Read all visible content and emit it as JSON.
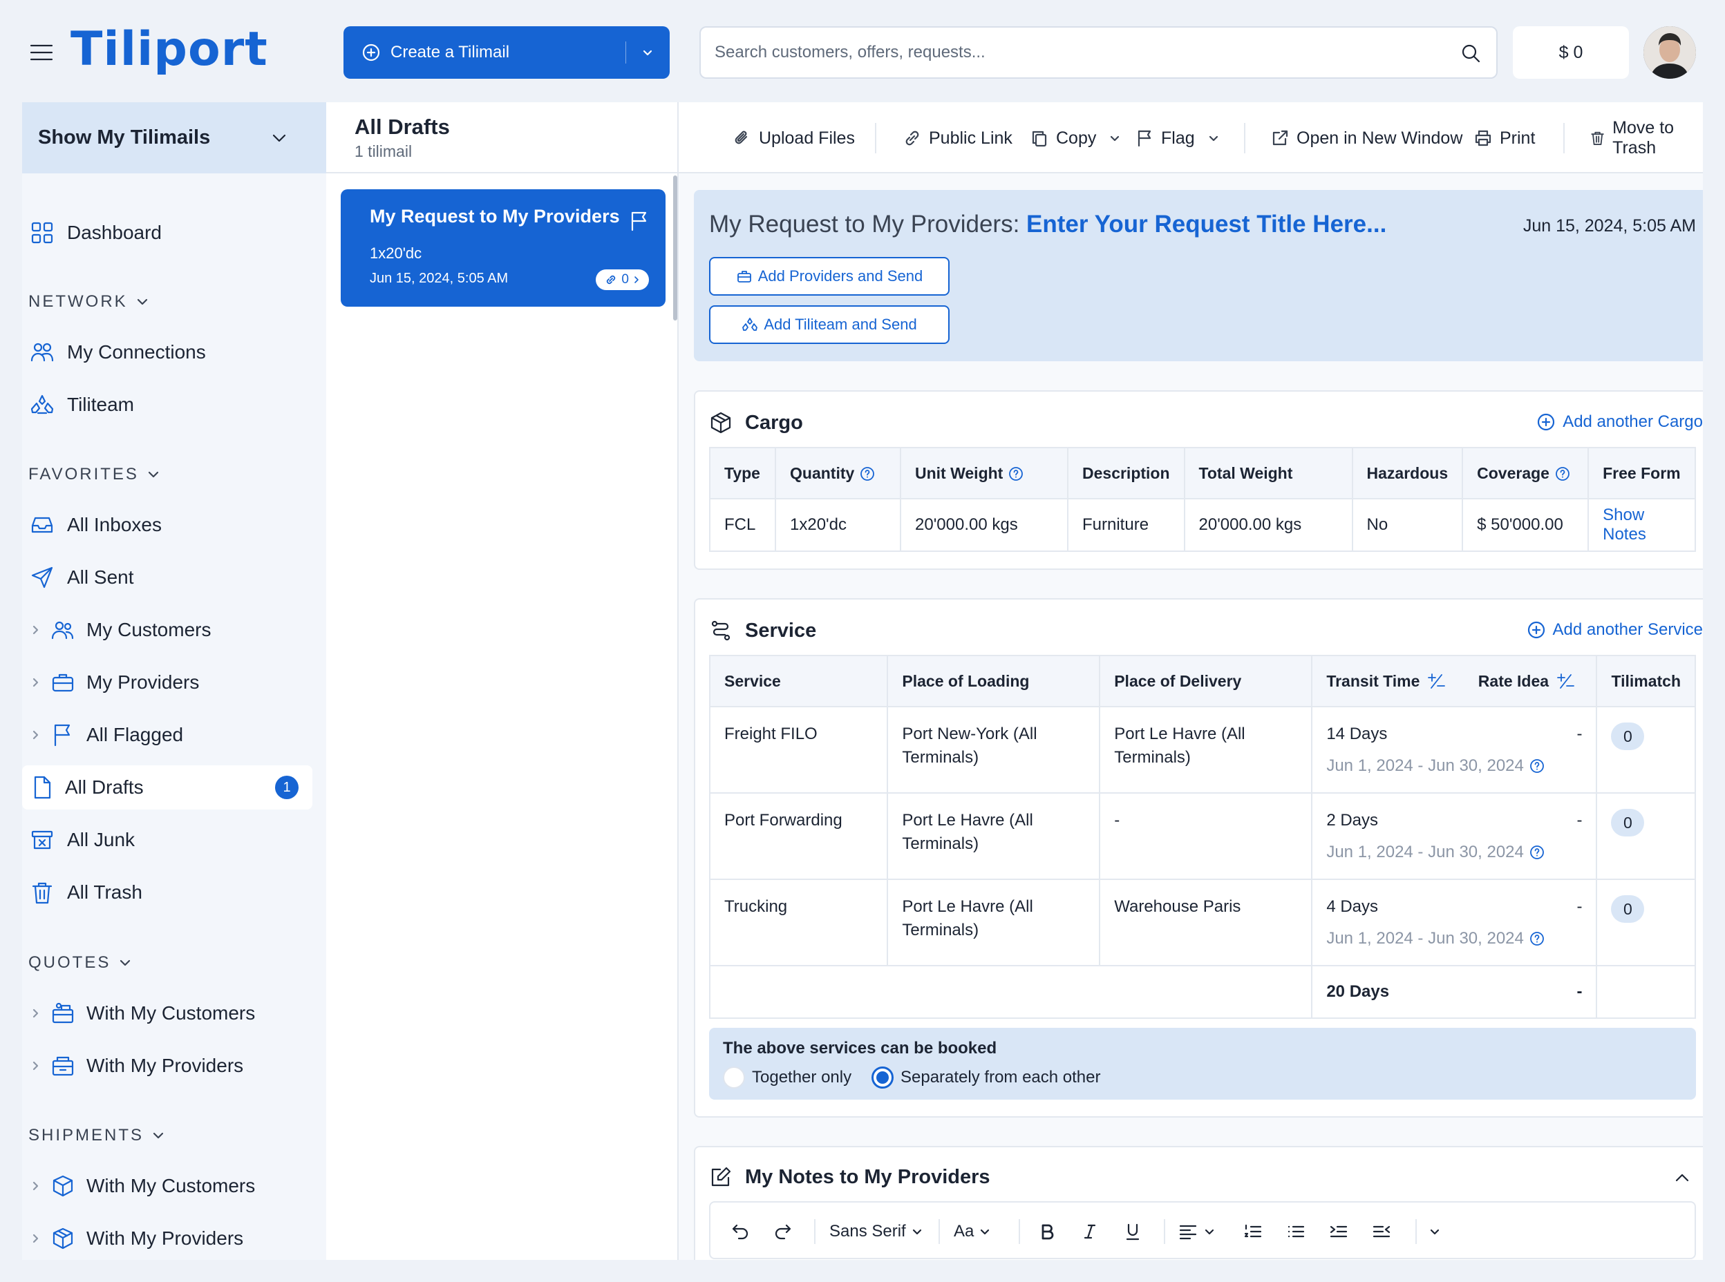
{
  "app": {
    "logo": "Tiliport"
  },
  "header": {
    "create_label": "Create a Tilimail",
    "search_placeholder": "Search customers, offers, requests...",
    "balance": "$ 0"
  },
  "sidebar": {
    "selector": "Show My Tilimails",
    "dashboard": "Dashboard",
    "network": {
      "title": "NETWORK",
      "items": [
        "My Connections",
        "Tiliteam"
      ]
    },
    "favorites": {
      "title": "FAVORITES",
      "items": [
        "All Inboxes",
        "All Sent",
        "My Customers",
        "My Providers",
        "All Flagged",
        "All Drafts",
        "All Junk",
        "All Trash"
      ],
      "drafts_count": "1"
    },
    "quotes": {
      "title": "QUOTES",
      "items": [
        "With My Customers",
        "With My Providers"
      ]
    },
    "shipments": {
      "title": "SHIPMENTS",
      "items": [
        "With My Customers",
        "With My Providers"
      ]
    }
  },
  "list": {
    "title": "All Drafts",
    "subtitle": "1 tilimail",
    "items": [
      {
        "title": "My Request to My Providers",
        "subject": "1x20'dc",
        "date": "Jun 15, 2024, 5:05 AM",
        "links": "0"
      }
    ]
  },
  "toolbar": {
    "upload": "Upload Files",
    "public_link": "Public Link",
    "copy": "Copy",
    "flag": "Flag",
    "open_new": "Open in New Window",
    "print": "Print",
    "trash": "Move to Trash"
  },
  "request": {
    "prefix": "My Request to My Providers:",
    "title_placeholder": "Enter Your Request Title Here...",
    "date": "Jun 15, 2024, 5:05 AM",
    "add_providers": "Add Providers and Send",
    "add_tiliteam": "Add Tiliteam and Send"
  },
  "cargo": {
    "title": "Cargo",
    "add": "Add another Cargo",
    "columns": [
      "Type",
      "Quantity",
      "Unit Weight",
      "Description",
      "Total Weight",
      "Hazardous",
      "Coverage",
      "Free Form"
    ],
    "row": [
      "FCL",
      "1x20'dc",
      "20'000.00 kgs",
      "Furniture",
      "20'000.00 kgs",
      "No",
      "$ 50'000.00",
      "Show Notes"
    ]
  },
  "service": {
    "title": "Service",
    "add": "Add another Service",
    "columns": [
      "Service",
      "Place of Loading",
      "Place of Delivery",
      "Transit Time",
      "Rate Idea",
      "Tilimatch"
    ],
    "rows": [
      {
        "service": "Freight FILO",
        "loading": "Port New-York (All Terminals)",
        "delivery": "Port Le Havre (All Terminals)",
        "transit": "14 Days",
        "range": "Jun 1, 2024 - Jun 30, 2024",
        "rate": "-",
        "match": "0"
      },
      {
        "service": "Port Forwarding",
        "loading": "Port Le Havre (All Terminals)",
        "delivery": "-",
        "transit": "2 Days",
        "range": "Jun 1, 2024 - Jun 30, 2024",
        "rate": "-",
        "match": "0"
      },
      {
        "service": "Trucking",
        "loading": "Port Le Havre (All Terminals)",
        "delivery": "Warehouse Paris",
        "transit": "4 Days",
        "range": "Jun 1, 2024 - Jun 30, 2024",
        "rate": "-",
        "match": "0"
      }
    ],
    "total_transit": "20 Days",
    "total_rate": "-",
    "booking_question": "The above services can be booked",
    "option_together": "Together only",
    "option_separately": "Separately from each other",
    "selected_option": "Separately from each other"
  },
  "notes": {
    "title": "My Notes to My Providers",
    "font": "Sans Serif",
    "size": "Aa"
  },
  "colors": {
    "accent": "#1664d3",
    "banner": "#d9e6f6",
    "sidebar": "#f3f6fb"
  }
}
